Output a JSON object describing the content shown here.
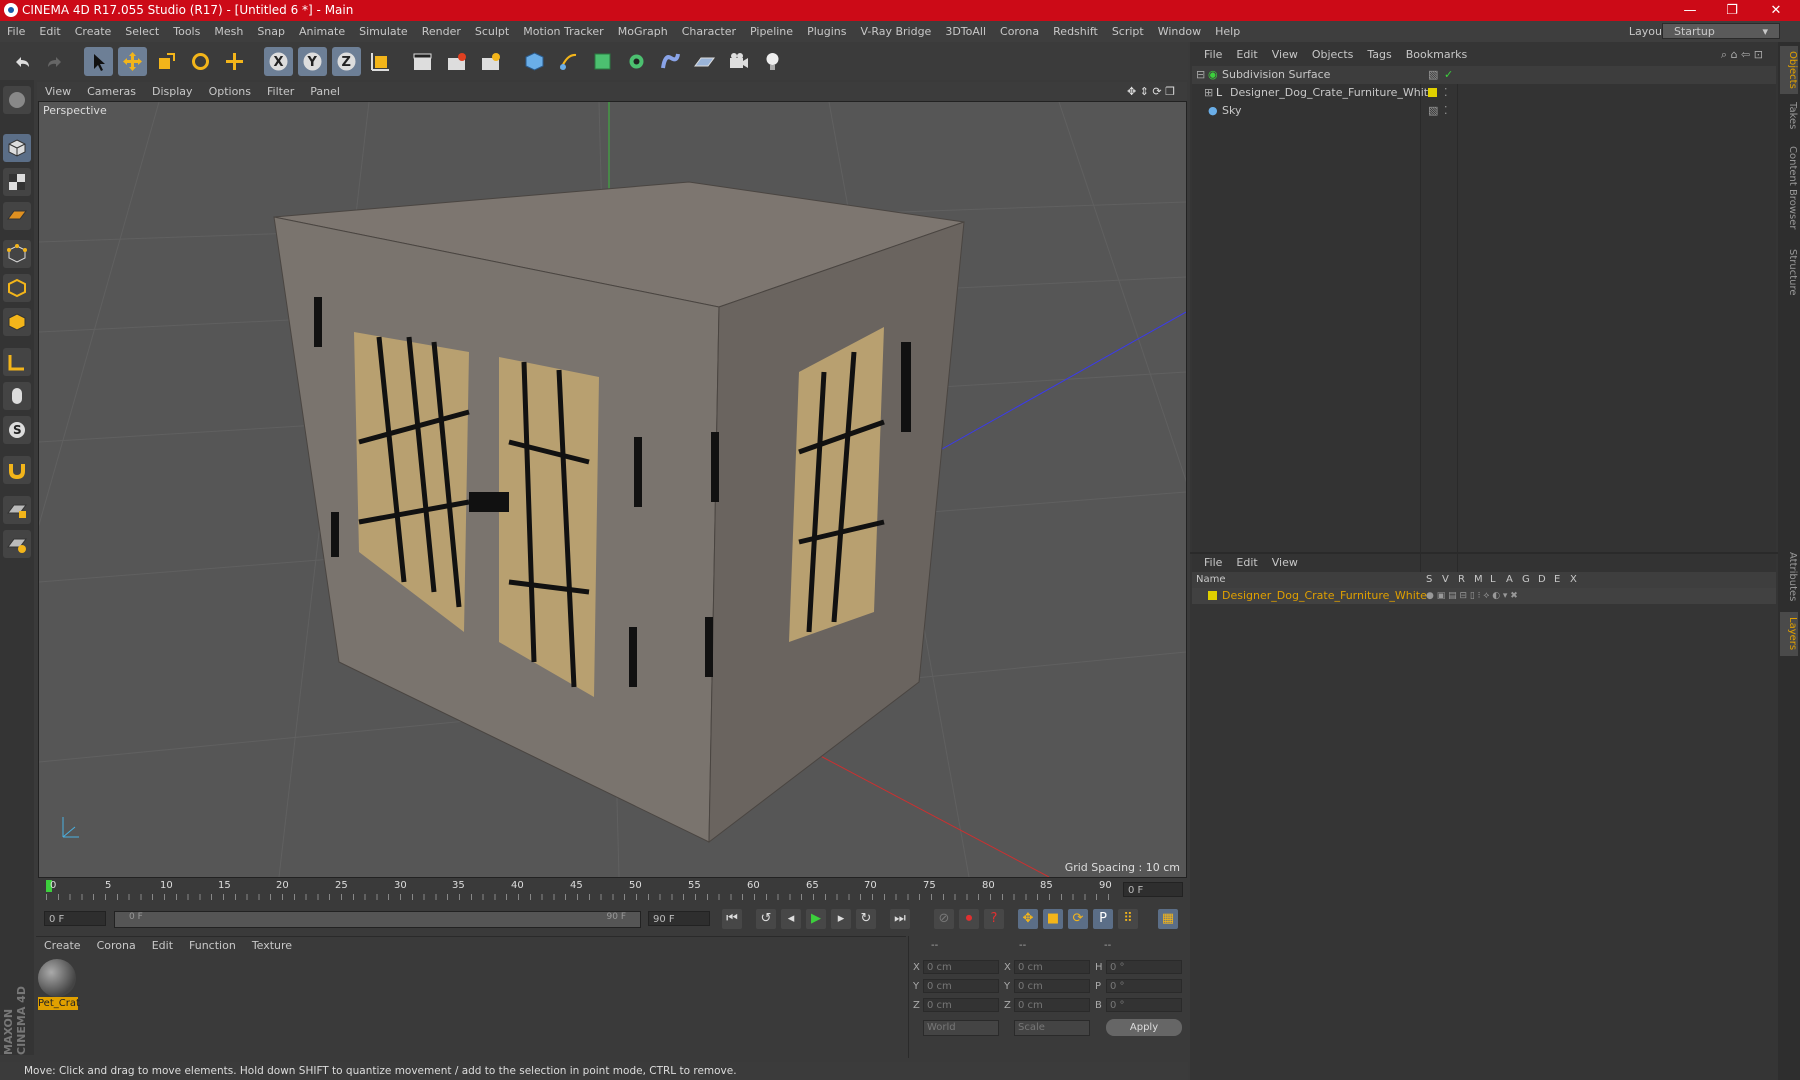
{
  "window": {
    "title": "CINEMA 4D R17.055 Studio (R17) - [Untitled 6 *] - Main",
    "controls": [
      "—",
      "❐",
      "✕"
    ]
  },
  "menubar": {
    "items": [
      "File",
      "Edit",
      "Create",
      "Select",
      "Tools",
      "Mesh",
      "Snap",
      "Animate",
      "Simulate",
      "Render",
      "Sculpt",
      "Motion Tracker",
      "MoGraph",
      "Character",
      "Pipeline",
      "Plugins",
      "V-Ray Bridge",
      "3DToAll",
      "Corona",
      "Redshift",
      "Script",
      "Window",
      "Help"
    ],
    "layout_label": "Layout:",
    "layout_value": "Startup"
  },
  "viewport": {
    "menu": [
      "View",
      "Cameras",
      "Display",
      "Options",
      "Filter",
      "Panel"
    ],
    "label": "Perspective",
    "grid_spacing": "Grid Spacing : 10 cm"
  },
  "timeline": {
    "ticks": [
      "0",
      "5",
      "10",
      "15",
      "20",
      "25",
      "30",
      "35",
      "40",
      "45",
      "50",
      "55",
      "60",
      "65",
      "70",
      "75",
      "80",
      "85",
      "90"
    ],
    "current_frame": "0 F",
    "start_field": "0 F",
    "slider_start": "0 F",
    "slider_end": "90 F",
    "end_field": "90 F"
  },
  "material_panel": {
    "menu": [
      "Create",
      "Corona",
      "Edit",
      "Function",
      "Texture"
    ],
    "material_name": "Pet_Crat"
  },
  "coords": {
    "headers": [
      "--",
      "--",
      "--"
    ],
    "rows": [
      {
        "l1": "X",
        "v1": "0 cm",
        "l2": "X",
        "v2": "0 cm",
        "l3": "H",
        "v3": "0 °"
      },
      {
        "l1": "Y",
        "v1": "0 cm",
        "l2": "Y",
        "v2": "0 cm",
        "l3": "P",
        "v3": "0 °"
      },
      {
        "l1": "Z",
        "v1": "0 cm",
        "l2": "Z",
        "v2": "0 cm",
        "l3": "B",
        "v3": "0 °"
      }
    ],
    "world": "World",
    "scale": "Scale",
    "apply": "Apply"
  },
  "status": "Move: Click and drag to move elements. Hold down SHIFT to quantize movement / add to the selection in point mode, CTRL to remove.",
  "objects_panel": {
    "menu": [
      "File",
      "Edit",
      "View",
      "Objects",
      "Tags",
      "Bookmarks"
    ],
    "items": [
      {
        "name": "Subdivision Surface"
      },
      {
        "name": "Designer_Dog_Crate_Furniture_White"
      },
      {
        "name": "Sky"
      }
    ]
  },
  "layers_panel": {
    "menu": [
      "File",
      "Edit",
      "View"
    ],
    "columns": [
      "Name",
      "S",
      "V",
      "R",
      "M",
      "L",
      "A",
      "G",
      "D",
      "E",
      "X"
    ],
    "layer_name": "Designer_Dog_Crate_Furniture_White"
  },
  "side_tabs": [
    "Objects",
    "Takes",
    "Content Browser",
    "Structure",
    "Attributes",
    "Layers"
  ],
  "brand": "MAXON CINEMA 4D",
  "colors": {
    "title_bar": "#cc0a17",
    "accent_orange": "#e0a000",
    "layer_yellow": "#e0d000",
    "selected_blue": "#5b6e87"
  }
}
